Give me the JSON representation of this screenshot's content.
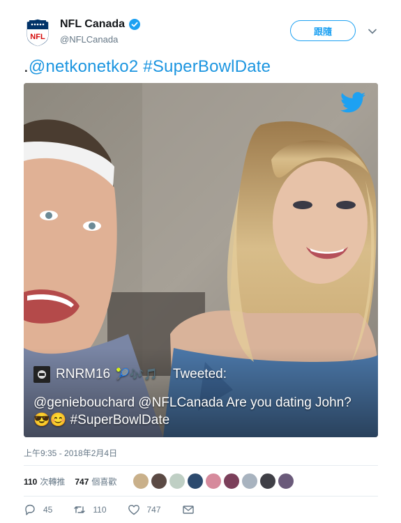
{
  "account": {
    "name": "NFL Canada",
    "handle": "@NFLCanada",
    "follow_label": "跟隨"
  },
  "tweet": {
    "prefix": ".",
    "mention": "@netkonetko2",
    "hashtag": "#SuperBowlDate"
  },
  "media": {
    "overlay_user": "RNRM16",
    "overlay_emoji": "🎾🎶🎵",
    "overlay_tweeted": "Tweeted:",
    "overlay_text": "@geniebouchard @NFLCanada Are you dating John? 😎😊 #SuperBowlDate"
  },
  "timestamp": "上午9:35 - 2018年2月4日",
  "stats": {
    "retweets_count": "110",
    "retweets_label": "次轉推",
    "likes_count": "747",
    "likes_label": "個喜歡"
  },
  "actions": {
    "reply_count": "45",
    "retweet_count": "110",
    "like_count": "747"
  },
  "colors": {
    "accent": "#1da1f2",
    "link": "#1b95e0",
    "muted": "#657786"
  }
}
